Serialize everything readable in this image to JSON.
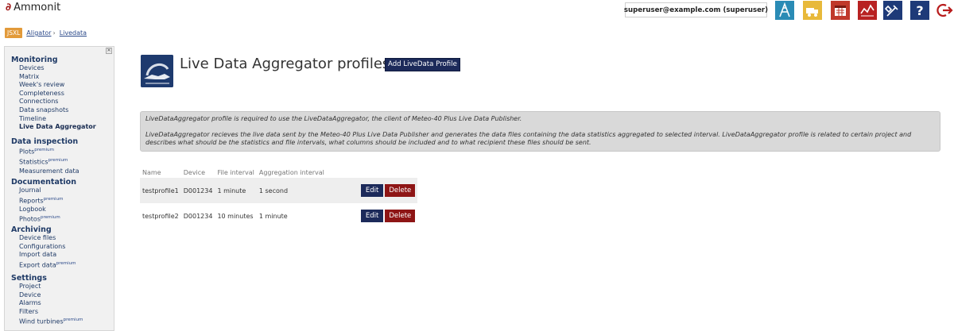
{
  "header": {
    "logo_text": "Ammonit",
    "user": "superuser@example.com (superuser)"
  },
  "breadcrumb": {
    "badge": "JSXL",
    "items": [
      "Aligator",
      "Livedata"
    ],
    "separator": "›"
  },
  "sidebar": {
    "sections": [
      {
        "title": "Monitoring",
        "items": [
          {
            "label": "Devices"
          },
          {
            "label": "Matrix"
          },
          {
            "label": "Week's review"
          },
          {
            "label": "Completeness"
          },
          {
            "label": "Connections"
          },
          {
            "label": "Data snapshots"
          },
          {
            "label": "Timeline"
          },
          {
            "label": "Live Data Aggregator",
            "active": true
          }
        ]
      },
      {
        "title": "Data inspection",
        "items": [
          {
            "label": "Plots",
            "premium": "premium"
          },
          {
            "label": "Statistics",
            "premium": "premium"
          },
          {
            "label": "Measurement data"
          }
        ]
      },
      {
        "title": "Documentation",
        "items": [
          {
            "label": "Journal"
          },
          {
            "label": "Reports",
            "premium": "premium"
          },
          {
            "label": "Logbook"
          },
          {
            "label": "Photos",
            "premium": "premium"
          }
        ]
      },
      {
        "title": "Archiving",
        "items": [
          {
            "label": "Device files"
          },
          {
            "label": "Configurations"
          },
          {
            "label": "Import data"
          },
          {
            "label": "Export data",
            "premium": "premium"
          }
        ]
      },
      {
        "title": "Settings",
        "items": [
          {
            "label": "Project"
          },
          {
            "label": "Device"
          },
          {
            "label": "Alarms"
          },
          {
            "label": "Filters"
          },
          {
            "label": "Wind turbines",
            "premium": "premium"
          }
        ]
      }
    ]
  },
  "main": {
    "title": "Live Data Aggregator profiles",
    "add_button": "Add LiveData Profile",
    "info_p1": "LiveDataAggregator profile is required to use the LiveDataAggregator, the client of Meteo-40 Plus Live Data Publisher.",
    "info_p2": "LiveDataAggregator recieves the live data sent by the Meteo-40 Plus Live Data Publisher and generates the data files containing the data statistics aggregated to selected interval. LiveDataAggregator profile is related to certain project and describes what should be the statistics and file intervals, what columns should be included and to what recipient these files should be sent.",
    "table": {
      "headers": [
        "Name",
        "Device",
        "File interval",
        "Aggregation interval"
      ],
      "rows": [
        {
          "name": "testprofile1",
          "device": "D001234",
          "file_interval": "1 minute",
          "aggregation_interval": "1 second"
        },
        {
          "name": "testprofile2",
          "device": "D001234",
          "file_interval": "10 minutes",
          "aggregation_interval": "1 minute"
        }
      ],
      "edit_label": "Edit",
      "delete_label": "Delete"
    }
  },
  "icons": [
    "tower-icon",
    "truck-icon",
    "calendar-icon",
    "chart-icon",
    "tools-icon",
    "help-icon",
    "logout-icon"
  ],
  "colors": {
    "accent": "#1c2a5a",
    "danger": "#8e1515",
    "badge": "#e29a3a",
    "brand": "#a01818"
  }
}
